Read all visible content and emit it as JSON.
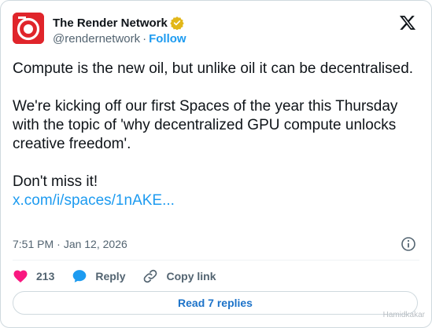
{
  "author": {
    "display_name": "The Render Network",
    "handle": "@rendernetwork",
    "separator": "·",
    "follow_label": "Follow",
    "avatar_icon": "render-logo-icon",
    "verified_icon": "verified-badge-icon"
  },
  "platform_icon": "x-logo-icon",
  "tweet": {
    "paragraphs": [
      "Compute is the new oil, but unlike oil it can be decentralised.",
      "We're kicking off our first Spaces of the year this Thursday with the topic of 'why decentralized GPU compute unlocks creative freedom'.",
      "Don't miss it!"
    ],
    "link_text": "x.com/i/spaces/1nAKE..."
  },
  "meta": {
    "time": "7:51 PM",
    "separator": "·",
    "date": "Jan 12, 2026"
  },
  "actions": {
    "like_count": "213",
    "reply_label": "Reply",
    "copy_link_label": "Copy link"
  },
  "read_replies_label": "Read 7 replies",
  "watermark": "Hamidkakar",
  "colors": {
    "brand_red": "#e0252b",
    "link_blue": "#1d9bf0",
    "like_pink": "#f91880",
    "verified_gold": "#e2b719"
  }
}
